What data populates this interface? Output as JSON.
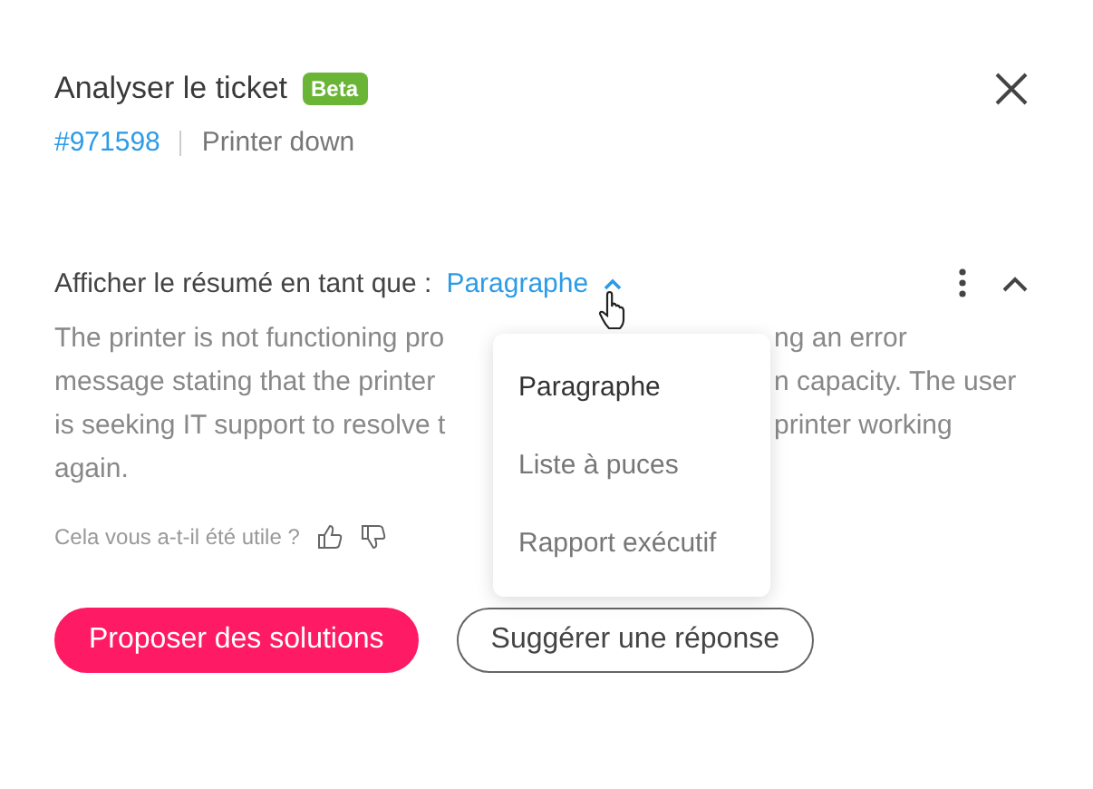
{
  "header": {
    "title": "Analyser le ticket",
    "badge": "Beta",
    "ticket_id": "#971598",
    "ticket_subject": "Printer down"
  },
  "summary": {
    "label": "Afficher le résumé en tant que :",
    "format": "Paragraphe",
    "menu_expanded": true,
    "expanded": true,
    "lines": [
      {
        "left": "The printer is not functioning pro",
        "right": "ng an error"
      },
      {
        "left": "message stating that the printer",
        "right": "n capacity. The user"
      },
      {
        "left": "is seeking IT support to resolve t",
        "right": "printer working"
      },
      {
        "left": "again."
      }
    ],
    "feedback_prompt": "Cela vous a-t-il été utile ?"
  },
  "format_menu": [
    {
      "label": "Paragraphe",
      "selected": true
    },
    {
      "label": "Liste à puces",
      "selected": false
    },
    {
      "label": "Rapport exécutif",
      "selected": false
    }
  ],
  "actions": [
    {
      "label": "Proposer des solutions",
      "kind": "primary"
    },
    {
      "label": "Suggérer une réponse",
      "kind": "secondary"
    }
  ]
}
